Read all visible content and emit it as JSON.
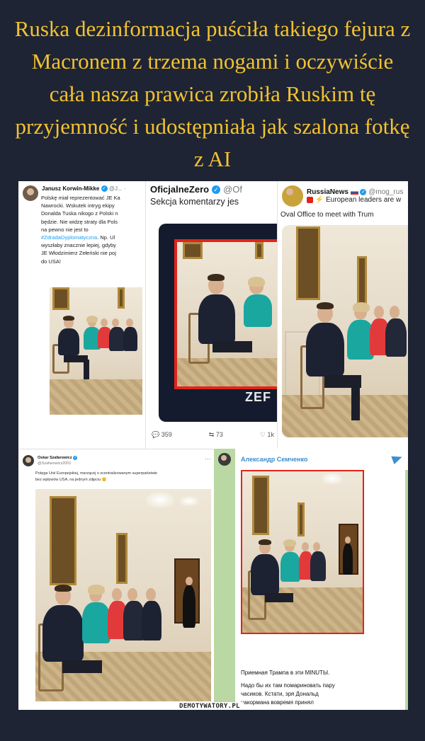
{
  "headline": "Ruska dezinformacja puściła takiego fejura z Macronem z trzema nogami i oczywiście cała nasza prawica zrobiła Ruskim tę przyjemność i udostępniała jak szalona fotkę z AI",
  "panel1": {
    "name": "Janusz Korwin-Mikke",
    "handle": "@J... ·",
    "lines": [
      "Polskę miał reprezentować JE Ka",
      "Nawrocki. Wskutek intryg ekipy",
      "Donalda Tuska nikogo z Polski n",
      "będzie. Nie widzę straty dla Pols",
      "na pewno nie jest to"
    ],
    "hashtag": "#ZdradaDyplomatyczna",
    "hashtag_suffix": ". Np. Ul",
    "lines2": [
      "wyszłaby znacznie lepiej, gdyby",
      "JE Włodzimierz Zełeński nie poj",
      "do USA!"
    ]
  },
  "panel2": {
    "name": "OficjalneZero",
    "handle": "@Of",
    "text": "Sekcja komentarzy jes",
    "logo": "ZEF",
    "replies": "359",
    "reposts": "73",
    "likes": "1k"
  },
  "panel3": {
    "name": "RussiaNews",
    "handle": "@mog_rus",
    "text1": "European leaders are w",
    "text2": "Oval Office to meet with Trum"
  },
  "panel4": {
    "name": "Oskar Szafarowicz",
    "handle": "@Szafarowicz2001",
    "text1": "Potęga Unii Europejskiej, marzącej o scentralizowanym superpaństwie",
    "text2": "bez wpływów USA, na jednym zdjęciu 🙂"
  },
  "panel5": {
    "name": "Александр Семченко",
    "msg1": "Приемная Трампа в эти MINUTЫ.",
    "msg2": "Надо бы их там помариновать пару",
    "msg3": "часиков. Кстати, зря Дональд",
    "msg4": "накормана вовремя принял"
  },
  "watermark": "DEMOTYWATORY.PL",
  "colors": {
    "headline": "#f2c230",
    "background": "#1e2433",
    "verified": "#1d9bf0",
    "telegram_bg": "#b9d8a4",
    "highlight_red": "#e2231a"
  }
}
